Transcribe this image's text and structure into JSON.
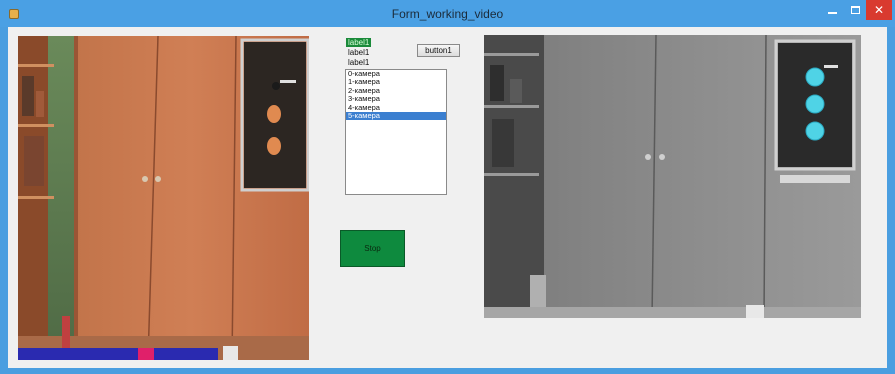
{
  "window": {
    "title": "Form_working_video"
  },
  "labels": {
    "label_a": "label1",
    "label_b": "label1",
    "label_c": "label1"
  },
  "buttons": {
    "button1": "button1",
    "stop": "Stop"
  },
  "camera_list": {
    "items": [
      "0-камера",
      "1-камера",
      "2-камера",
      "3-камера",
      "4-камера",
      "5-камера"
    ],
    "selected_index": 5
  },
  "colors": {
    "titlebar": "#4aa0e4",
    "close_button": "#d93a2f",
    "stop_button": "#0e8a3e",
    "selection": "#3b7fd0",
    "detected_circle": "#4fd3e6"
  },
  "icons": {
    "app": "app-icon",
    "minimize": "minimize-icon",
    "maximize": "maximize-icon",
    "close": "close-icon"
  }
}
